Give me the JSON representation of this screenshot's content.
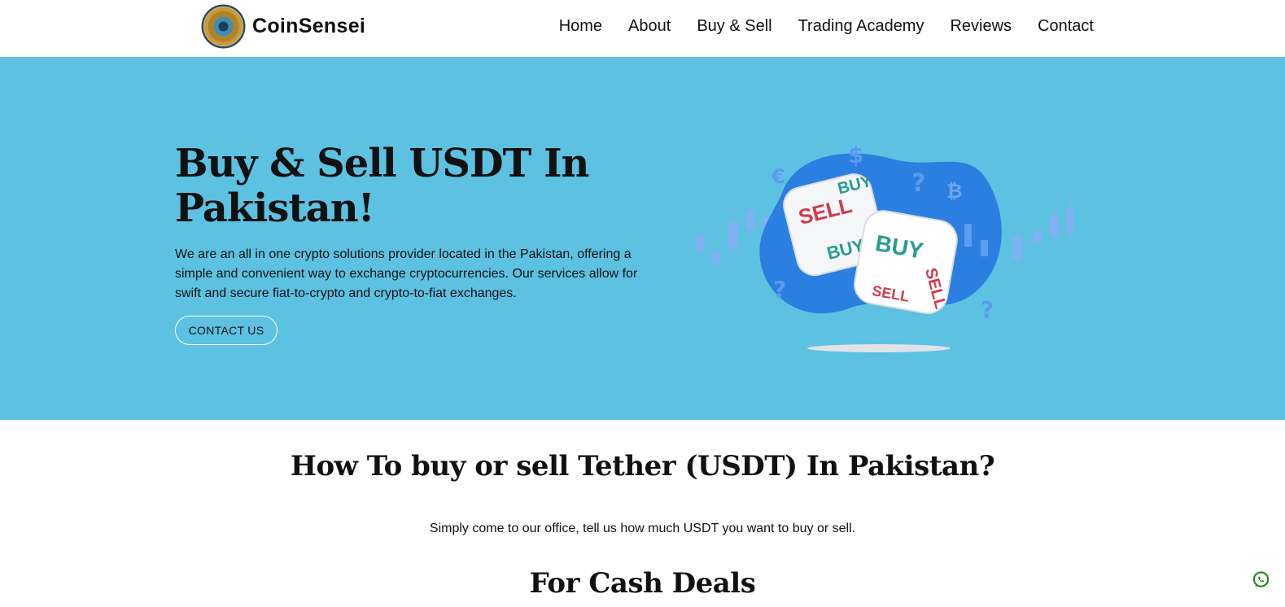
{
  "header": {
    "brand": "CoinSensei",
    "nav": [
      "Home",
      "About",
      "Buy & Sell",
      "Trading Academy",
      "Reviews",
      "Contact"
    ]
  },
  "hero": {
    "title": "Buy & Sell USDT In Pakistan!",
    "description": "We are an all in one crypto solutions provider located in the Pakistan, offering a simple and convenient way to exchange cryptocurrencies. Our services allow for swift and secure fiat-to-crypto and crypto-to-fiat exchanges.",
    "button": "CONTACT US",
    "illustration": {
      "dice_front": [
        "BUY",
        "SELL",
        "SELL"
      ],
      "dice_back": [
        "SELL",
        "BUY",
        "BUY"
      ]
    }
  },
  "section": {
    "title": "How To buy or sell Tether (USDT) In Pakistan?",
    "text": "Simply come to our office, tell us how much USDT you want to buy or sell.",
    "title2": "For Cash Deals"
  },
  "colors": {
    "hero_bg": "#5dc1e1",
    "blob": "#2b7fe0",
    "sell_red": "#d23a4a",
    "buy_teal": "#2a9c8e",
    "whatsapp": "#1a8a1a"
  },
  "icons": {
    "whatsapp": "whatsapp-icon",
    "logo": "coin-logo"
  }
}
